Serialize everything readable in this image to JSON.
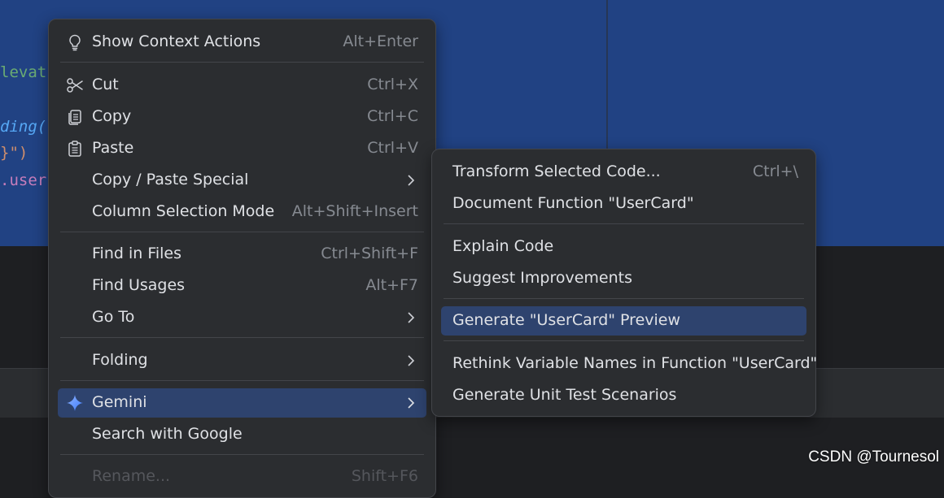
{
  "editor": {
    "code_fragments": [
      "levat",
      "ding(",
      "}\")",
      ".user"
    ]
  },
  "context_menu": {
    "items": [
      {
        "label": "Show Context Actions",
        "shortcut": "Alt+Enter",
        "icon": "lightbulb-icon"
      },
      {
        "label": "Cut",
        "shortcut": "Ctrl+X",
        "icon": "scissors-icon"
      },
      {
        "label": "Copy",
        "shortcut": "Ctrl+C",
        "icon": "copy-icon"
      },
      {
        "label": "Paste",
        "shortcut": "Ctrl+V",
        "icon": "clipboard-icon"
      },
      {
        "label": "Copy / Paste Special",
        "submenu": true
      },
      {
        "label": "Column Selection Mode",
        "shortcut": "Alt+Shift+Insert"
      },
      {
        "label": "Find in Files",
        "shortcut": "Ctrl+Shift+F"
      },
      {
        "label": "Find Usages",
        "shortcut": "Alt+F7"
      },
      {
        "label": "Go To",
        "submenu": true
      },
      {
        "label": "Folding",
        "submenu": true
      },
      {
        "label": "Gemini",
        "submenu": true,
        "selected": true,
        "icon": "gemini-sparkle-icon"
      },
      {
        "label": "Search with Google"
      },
      {
        "label": "Rename...",
        "shortcut": "Shift+F6",
        "disabled": true
      }
    ]
  },
  "gemini_submenu": {
    "items": [
      {
        "label": "Transform Selected Code...",
        "shortcut": "Ctrl+\\"
      },
      {
        "label": "Document Function \"UserCard\""
      },
      {
        "label": "Explain Code"
      },
      {
        "label": "Suggest Improvements"
      },
      {
        "label": "Generate \"UserCard\" Preview",
        "selected": true
      },
      {
        "label": "Rethink Variable Names in Function \"UserCard\""
      },
      {
        "label": "Generate Unit Test Scenarios"
      }
    ]
  },
  "watermark": "CSDN @Tournesol",
  "colors": {
    "menu_bg": "#2b2d30",
    "selection": "#2e436e",
    "editor_selection": "#214283",
    "gemini_accent": "#4a8cff"
  }
}
